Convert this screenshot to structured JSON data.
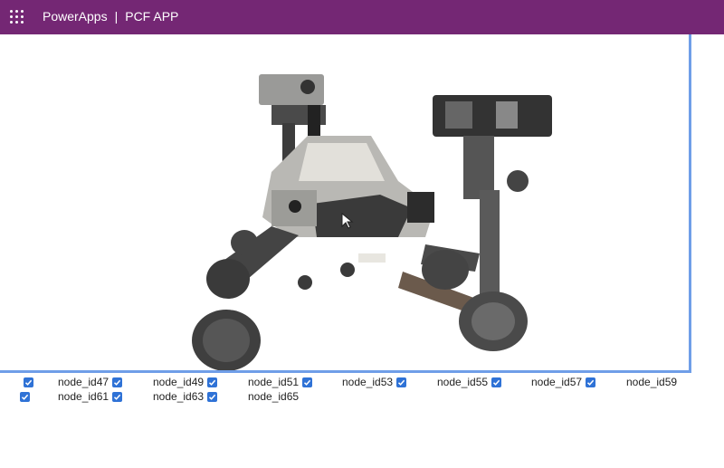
{
  "header": {
    "app_name": "PowerApps",
    "separator": "|",
    "page_name": "PCF APP"
  },
  "colors": {
    "header_bg": "#742774",
    "viewer_border": "#6f9ee8",
    "checkbox": "#2f72d6"
  },
  "viewer": {
    "content": "3D rover model",
    "cursor_icon": "mouse-pointer-icon"
  },
  "nodes": {
    "row1": [
      {
        "label": "",
        "checked": true
      },
      {
        "label": "node_id47",
        "checked": true
      },
      {
        "label": "node_id49",
        "checked": true
      },
      {
        "label": "node_id51",
        "checked": true
      },
      {
        "label": "node_id53",
        "checked": true
      },
      {
        "label": "node_id55",
        "checked": true
      },
      {
        "label": "node_id57",
        "checked": true
      },
      {
        "label": "node_id59",
        "checked": true
      }
    ],
    "row2": [
      {
        "label": "node_id61",
        "checked": true
      },
      {
        "label": "node_id63",
        "checked": true
      },
      {
        "label": "node_id65",
        "checked": true
      }
    ]
  }
}
